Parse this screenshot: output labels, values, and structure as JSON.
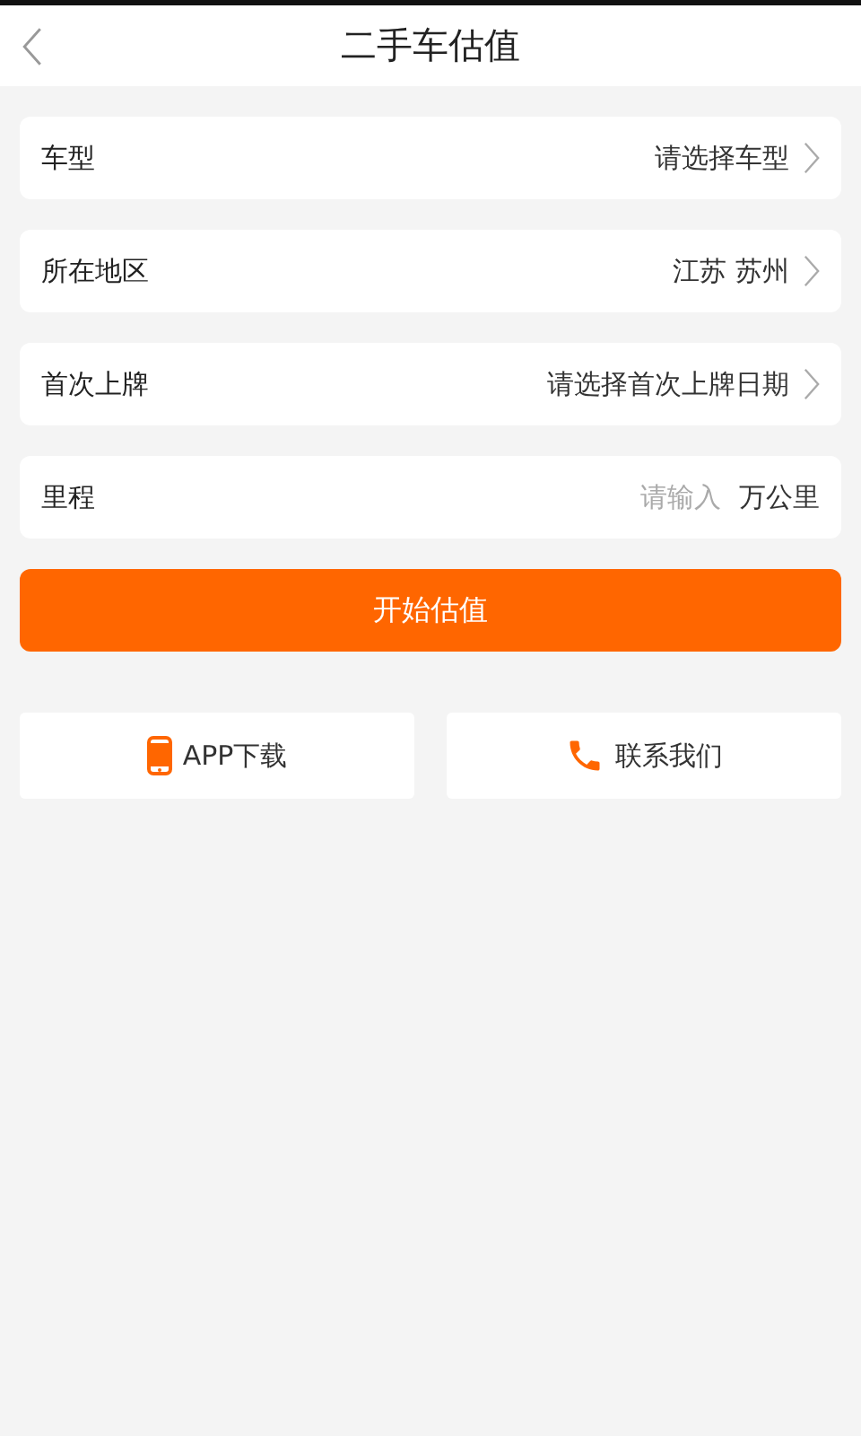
{
  "header": {
    "title": "二手车估值"
  },
  "fields": [
    {
      "kind": "select",
      "label": "车型",
      "value": "请选择车型"
    },
    {
      "kind": "select",
      "label": "所在地区",
      "value": "江苏 苏州"
    },
    {
      "kind": "select",
      "label": "首次上牌",
      "value": "请选择首次上牌日期"
    },
    {
      "kind": "input",
      "label": "里程",
      "placeholder": "请输入",
      "unit": "万公里"
    }
  ],
  "submit": "开始估值",
  "actions": [
    {
      "kind": "phone",
      "label": "APP下载"
    },
    {
      "kind": "call",
      "label": "联系我们"
    }
  ]
}
